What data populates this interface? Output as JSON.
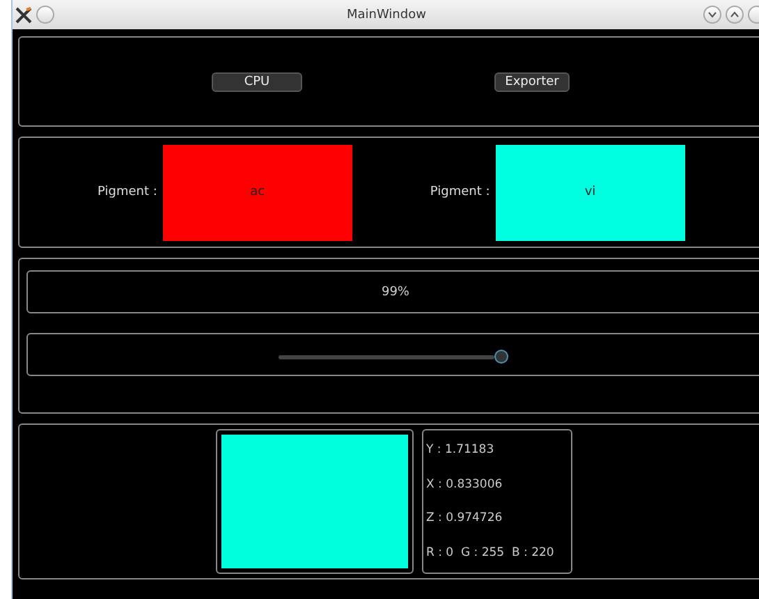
{
  "window": {
    "title": "MainWindow"
  },
  "toolbar": {
    "buttons": [
      "CPU",
      "Exporter"
    ]
  },
  "pigments": [
    {
      "label": "Pigment :",
      "name": "ac",
      "color": "#ff0000"
    },
    {
      "label": "Pigment :",
      "name": "vi",
      "color": "#00ffe0"
    }
  ],
  "progress": {
    "text": "99%"
  },
  "slider": {
    "level": 0.99
  },
  "result": {
    "color": "#00ffdc",
    "lines": [
      "Y : 1.71183",
      "X : 0.833006",
      "Z : 0.974726",
      "R : 0  G : 255  B : 220"
    ]
  }
}
